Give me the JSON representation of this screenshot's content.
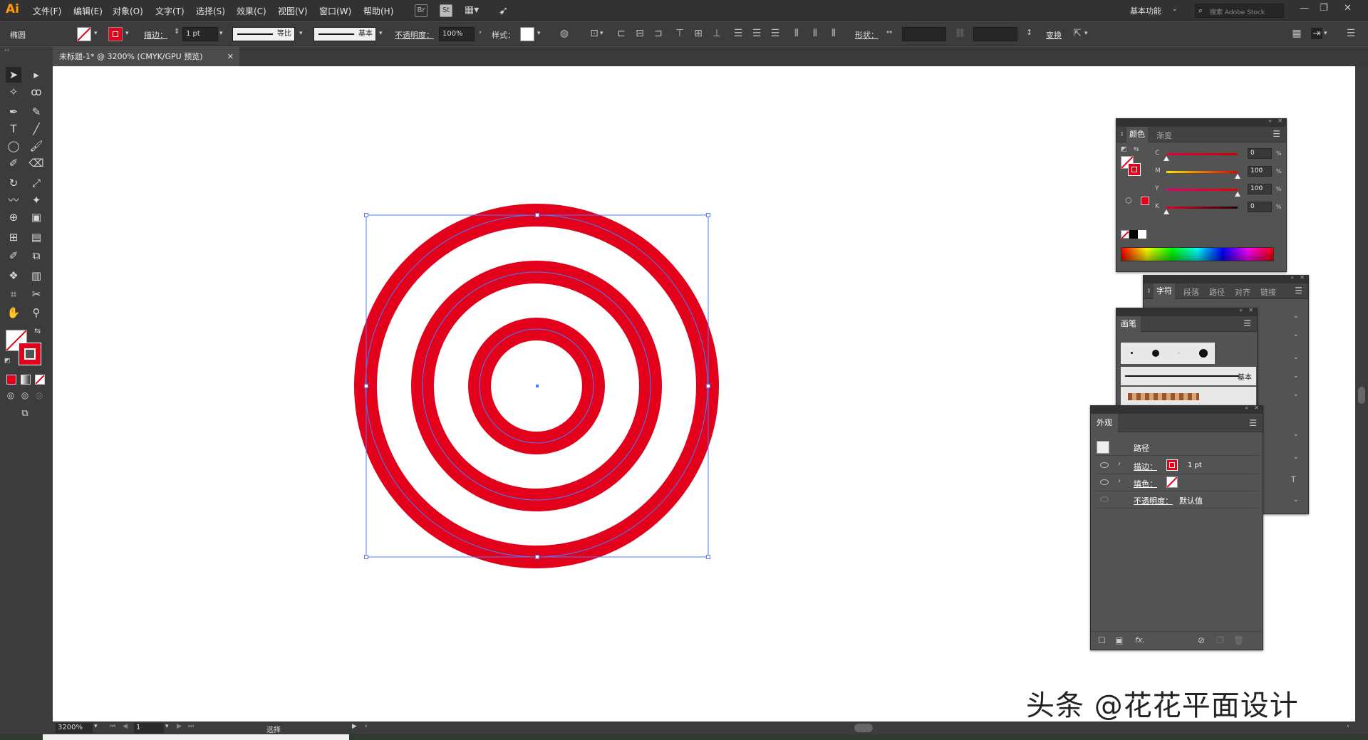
{
  "app": {
    "logo": "Ai"
  },
  "menu": [
    "文件(F)",
    "编辑(E)",
    "对象(O)",
    "文字(T)",
    "选择(S)",
    "效果(C)",
    "视图(V)",
    "窗口(W)",
    "帮助(H)"
  ],
  "menubar_icons": {
    "br": "Br",
    "st": "St"
  },
  "workspace": {
    "label": "基本功能"
  },
  "search": {
    "placeholder": "搜索 Adobe Stock"
  },
  "control": {
    "object_label": "椭圆",
    "stroke_label": "描边：",
    "stroke_value": "1 pt",
    "profile_label": "等比",
    "brush_label": "基本",
    "opacity_label": "不透明度：",
    "opacity_value": "100%",
    "style_label": "样式：",
    "shape_label": "形状：",
    "transform_label": "变换"
  },
  "document_tab": {
    "title": "未标题-1* @ 3200% (CMYK/GPU 预览)"
  },
  "status": {
    "zoom": "3200%",
    "page": "1",
    "tool": "选择"
  },
  "color_panel": {
    "tabs": [
      "颜色",
      "渐变"
    ],
    "channels": [
      {
        "name": "C",
        "value": "0",
        "level": 0,
        "gradient": [
          "#e4003a",
          "#cc0000"
        ]
      },
      {
        "name": "M",
        "value": "100",
        "level": 1,
        "gradient": [
          "#ffe600",
          "#e30000"
        ]
      },
      {
        "name": "Y",
        "value": "100",
        "level": 1,
        "gradient": [
          "#e4006e",
          "#e30000"
        ]
      },
      {
        "name": "K",
        "value": "0",
        "level": 0,
        "gradient": [
          "#e4001f",
          "#2a0000"
        ]
      }
    ],
    "unit": "%"
  },
  "char_panel": {
    "tabs": [
      "字符",
      "段落",
      "路径",
      "对齐",
      "链接"
    ]
  },
  "brush_panel": {
    "title": "画笔",
    "basic_label": "基本"
  },
  "appearance_panel": {
    "title": "外观",
    "object_label": "路径",
    "stroke_label": "描边：",
    "stroke_value": "1 pt",
    "fill_label": "填色：",
    "opacity_label": "不透明度：",
    "opacity_value": "默认值"
  },
  "colors": {
    "ring_red": "#e3001b",
    "selection_blue": "#4a7bff"
  },
  "watermark": "头条 @花花平面设计"
}
